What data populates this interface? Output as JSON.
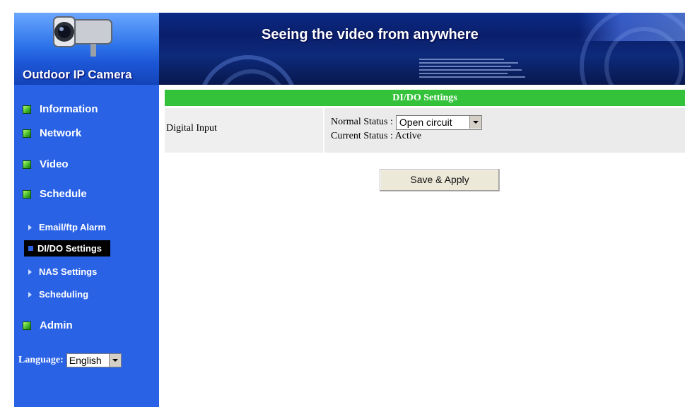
{
  "header": {
    "brand": "Outdoor IP Camera",
    "tagline": "Seeing the video from anywhere"
  },
  "sidebar": {
    "items": [
      {
        "label": "Information",
        "icon": "green-square-icon"
      },
      {
        "label": "Network",
        "icon": "green-square-icon"
      },
      {
        "label": "Video",
        "icon": "green-square-icon"
      },
      {
        "label": "Schedule",
        "icon": "green-square-icon"
      }
    ],
    "sub_items": [
      {
        "label": "Email/ftp Alarm"
      },
      {
        "label": "DI/DO Settings",
        "active": true
      },
      {
        "label": "NAS Settings"
      },
      {
        "label": "Scheduling"
      }
    ],
    "admin": {
      "label": "Admin",
      "icon": "green-square-icon"
    },
    "language": {
      "label": "Language:",
      "value": "English"
    }
  },
  "main": {
    "section_title": "DI/DO Settings",
    "row_label": "Digital Input",
    "normal_status_label": "Normal Status :",
    "normal_status_value": "Open circuit",
    "current_status_label": "Current Status :",
    "current_status_value": "Active",
    "save_button": "Save & Apply"
  },
  "colors": {
    "sidebar_bg": "#2a62e6",
    "section_bar": "#33c23a",
    "active_item_bg": "#000000"
  }
}
